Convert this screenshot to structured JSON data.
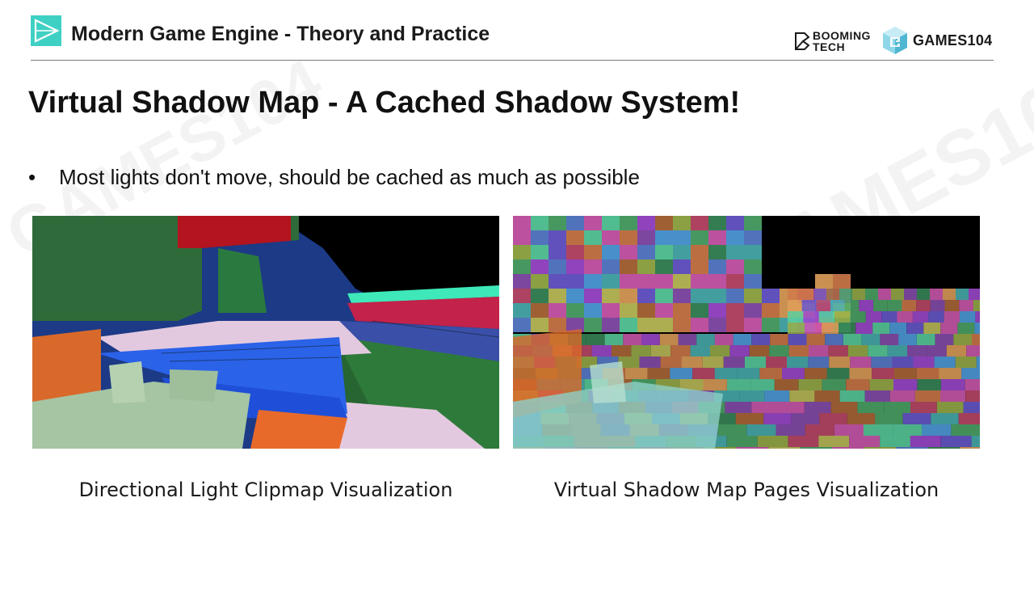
{
  "header": {
    "course_title": "Modern Game Engine - Theory and Practice",
    "logo_booming_line1": "BOOMING",
    "logo_booming_line2": "TECH",
    "logo_games": "GAMES104"
  },
  "slide": {
    "title": "Virtual Shadow Map - A Cached Shadow System!",
    "bullet_marker": "•",
    "bullet": "Most lights don't move, should be cached as much as possible"
  },
  "figures": [
    {
      "caption": "Directional Light Clipmap Visualization",
      "image": "directional-light-clipmap-render"
    },
    {
      "caption": "Virtual Shadow Map Pages Visualization",
      "image": "virtual-shadow-map-pages-render"
    }
  ],
  "colors": {
    "accent_icon": "#3fd0c4",
    "rule": "#7a7a7a",
    "text": "#111111"
  }
}
